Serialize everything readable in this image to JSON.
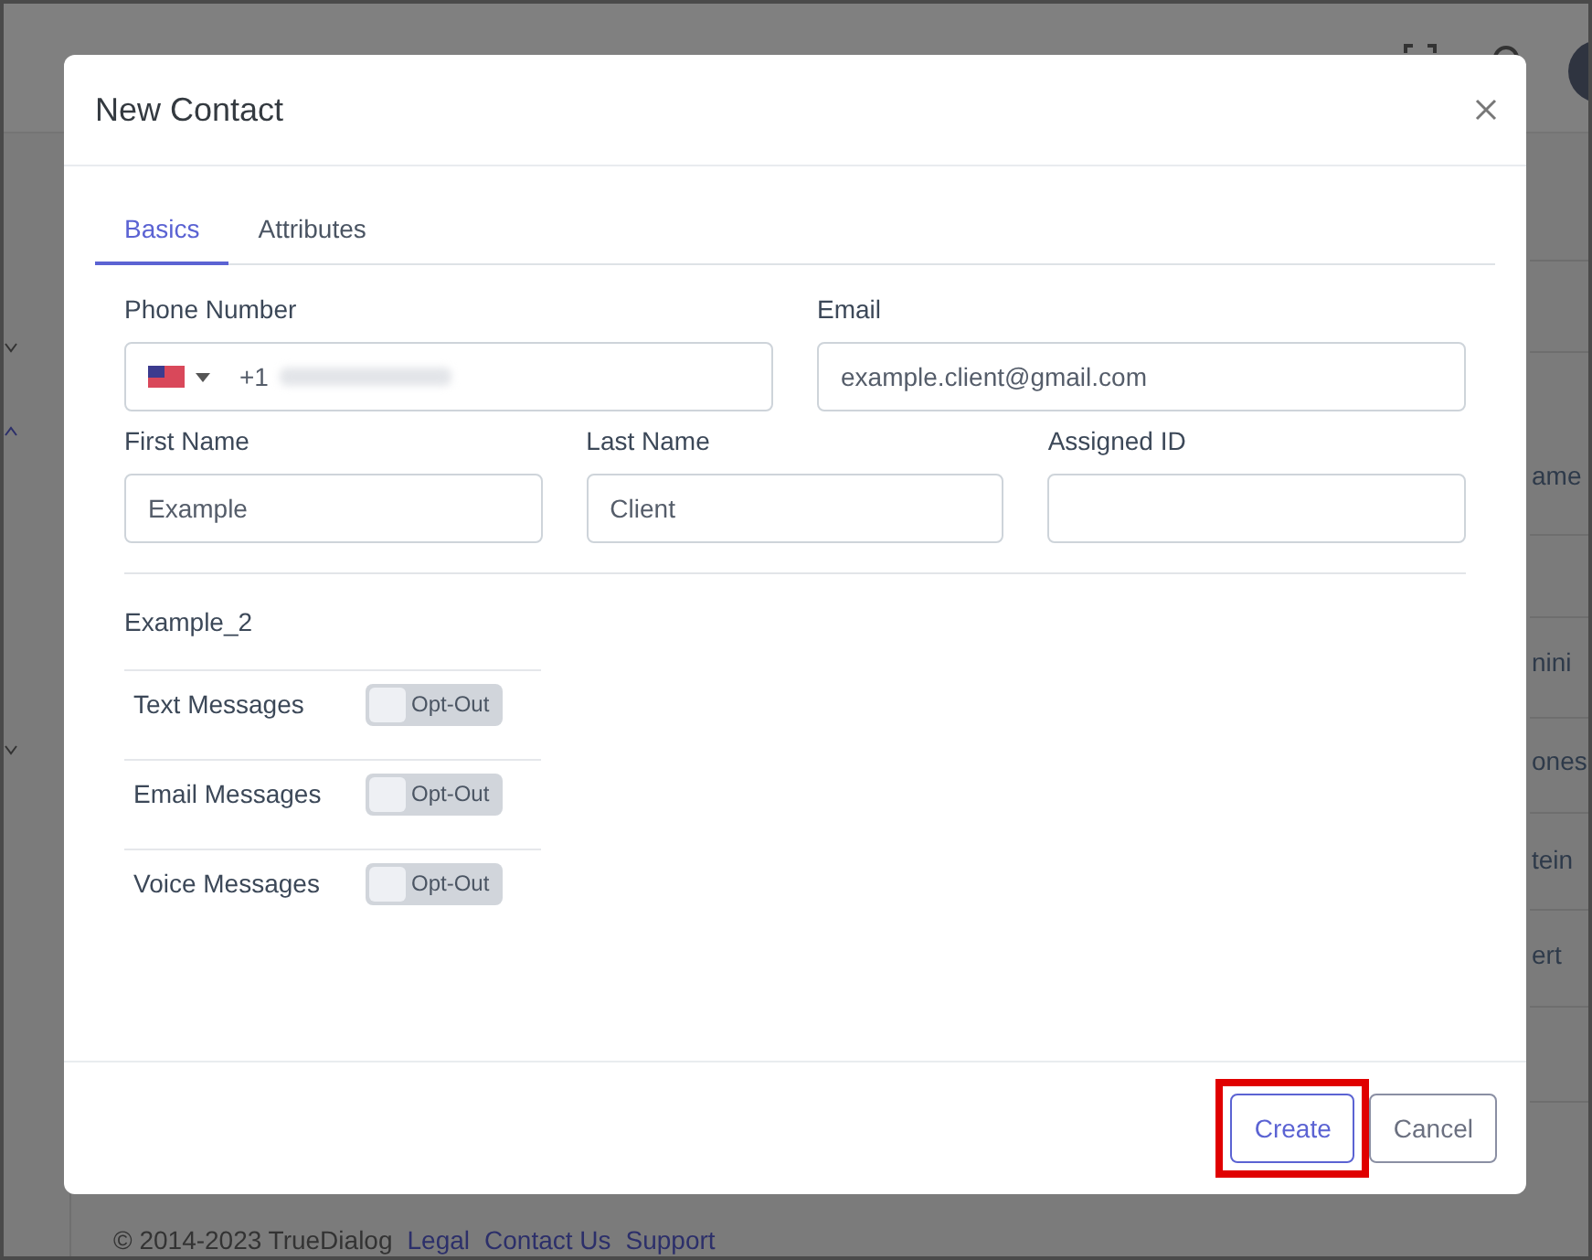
{
  "background": {
    "table_fragments": [
      "ame",
      "nini",
      "ones",
      "tein",
      "ert"
    ],
    "footer": [
      "© 2014-2023 TrueDialog",
      "Legal",
      "Contact Us",
      "Support"
    ]
  },
  "dialog": {
    "title": "New Contact",
    "tabs": [
      {
        "label": "Basics",
        "selected": true
      },
      {
        "label": "Attributes",
        "selected": false
      }
    ],
    "contact_fields": [
      {
        "kind": "phone",
        "label": "Phone Number",
        "prefix": "+1"
      },
      {
        "kind": "text",
        "label": "Email",
        "value": "example.client@gmail.com"
      }
    ],
    "name_fields": [
      {
        "kind": "text",
        "label": "First Name",
        "value": "Example"
      },
      {
        "kind": "text",
        "label": "Last Name",
        "value": "Client"
      },
      {
        "kind": "text",
        "label": "Assigned ID"
      }
    ],
    "section": "Example_2",
    "subscriptions": [
      {
        "label": "Text Messages",
        "on": false,
        "state_label": "Opt-Out"
      },
      {
        "label": "Email Messages",
        "on": false,
        "state_label": "Opt-Out"
      },
      {
        "label": "Voice Messages",
        "on": false,
        "state_label": "Opt-Out"
      }
    ],
    "buttons": [
      {
        "label": "Create",
        "kind": "primary",
        "highlighted": true
      },
      {
        "label": "Cancel",
        "kind": "secondary",
        "highlighted": false
      }
    ]
  }
}
